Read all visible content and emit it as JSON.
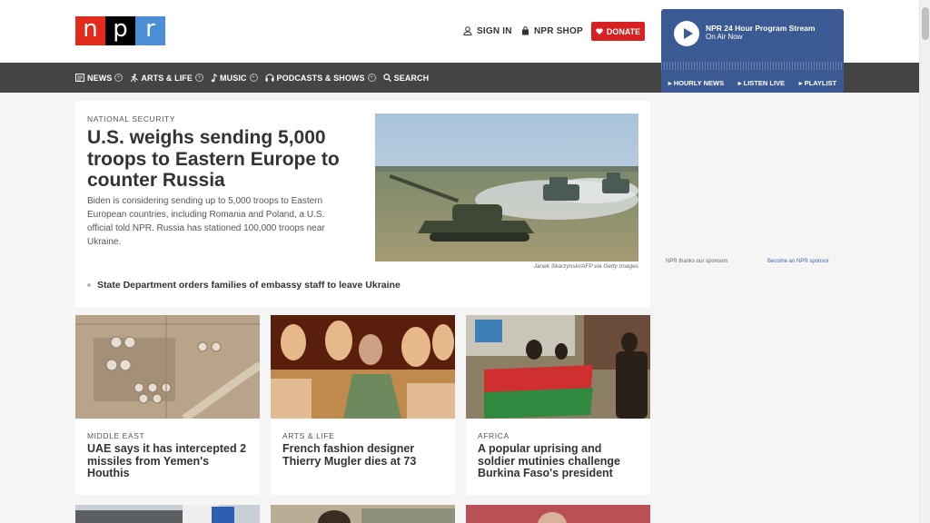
{
  "logo": {
    "letters": [
      "n",
      "p",
      "r"
    ]
  },
  "header": {
    "sign_in": "SIGN IN",
    "shop": "NPR SHOP",
    "donate": "DONATE"
  },
  "player": {
    "title": "NPR 24 Hour Program Stream",
    "subtitle": "On Air Now",
    "links": [
      "HOURLY NEWS",
      "LISTEN LIVE",
      "PLAYLIST"
    ]
  },
  "nav": {
    "items": [
      {
        "label": "NEWS",
        "icon": "news-icon"
      },
      {
        "label": "ARTS & LIFE",
        "icon": "arts-icon"
      },
      {
        "label": "MUSIC",
        "icon": "music-note-icon"
      },
      {
        "label": "PODCASTS & SHOWS",
        "icon": "headphones-icon"
      },
      {
        "label": "SEARCH",
        "icon": "search-icon"
      }
    ]
  },
  "lead": {
    "slug": "NATIONAL SECURITY",
    "headline": "U.S. weighs sending 5,000 troops to Eastern Europe to counter Russia",
    "teaser": "Biden is considering sending up to 5,000 troops to Eastern European countries, including Romania and Poland, a U.S. official told NPR. Russia has stationed 100,000 troops near Ukraine.",
    "credit": "Janek Skarzynski/AFP via Getty Images",
    "related": "State Department orders families of embassy staff to leave Ukraine"
  },
  "sponsor": {
    "thanks": "NPR thanks our sponsors",
    "become": "Become an NPR sponsor"
  },
  "cards": [
    {
      "slug": "MIDDLE EAST",
      "headline": "UAE says it has intercepted 2 missiles from Yemen's Houthis"
    },
    {
      "slug": "ARTS & LIFE",
      "headline": "French fashion designer Thierry Mugler dies at 73"
    },
    {
      "slug": "AFRICA",
      "headline": "A popular uprising and soldier mutinies challenge Burkina Faso's president"
    }
  ],
  "colors": {
    "brand_red": "#e32b1c",
    "brand_blue": "#4a8fd6",
    "nav_bg": "#444444",
    "donate_red": "#d62021",
    "player_blue": "#3b5a94"
  }
}
